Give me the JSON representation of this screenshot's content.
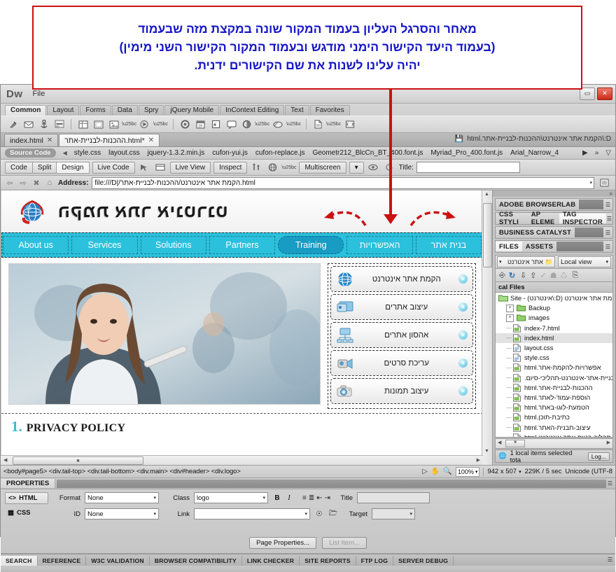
{
  "callout": {
    "line1": "מאחר והסרגל העליון בעמוד המקור שונה במקצת מזה שבעמוד",
    "line2": "(בעמוד היעד הקישור הימני מודגש ובעמוד המקור הקישור השני מימין)",
    "line3": "יהיה עלינו לשנות את שם הקישורים ידנית."
  },
  "window": {
    "app_logo": "Dw",
    "menu_file": "File",
    "minimize": "▭",
    "close": "✕"
  },
  "insert_panel": {
    "categories": [
      "Common",
      "Layout",
      "Forms",
      "Data",
      "Spry",
      "jQuery Mobile",
      "InContext Editing",
      "Text",
      "Favorites"
    ],
    "active_category": "Common"
  },
  "doc_tabs": [
    {
      "label": "index.html",
      "close": "✕",
      "active": false
    },
    {
      "label": "ההכנות-לבניית-אתר.html*",
      "close": "✕",
      "active": true
    }
  ],
  "doc_path": "D:\\הקמת אתר אינטרנט\\ההכנות-לבניית-אתר.html",
  "related_files": {
    "source_code": "Source Code",
    "files": [
      "style.css",
      "layout.css",
      "jquery-1.3.2.min.js",
      "cufon-yui.js",
      "cufon-replace.js",
      "Geometr212_BlcCn_BT_400.font.js",
      "Myriad_Pro_400.font.js",
      "Arial_Narrow_4"
    ],
    "more": "»",
    "filter": "filter-icon"
  },
  "view_toolbar": {
    "code": "Code",
    "split": "Split",
    "design": "Design",
    "active_view": "Design",
    "live_code": "Live Code",
    "live_view": "Live View",
    "inspect": "Inspect",
    "multiscreen": "Multiscreen",
    "title_label": "Title:",
    "title_value": ""
  },
  "address_bar": {
    "label": "Address:",
    "value": "file:///D|/הקמת אתר אינטרנט/ההכנות-לבניית-אתר.html"
  },
  "site": {
    "logo_text": "הקמת אתר אינטרנט",
    "nav": [
      {
        "label": "בנית אתר",
        "rtl": true,
        "selected": false
      },
      {
        "label": "האפשרויות",
        "rtl": true,
        "selected": false
      },
      {
        "label": "Training",
        "rtl": false,
        "selected": true
      },
      {
        "label": "Partners",
        "rtl": false,
        "selected": false
      },
      {
        "label": "Solutions",
        "rtl": false,
        "selected": false
      },
      {
        "label": "Services",
        "rtl": false,
        "selected": false
      },
      {
        "label": "About us",
        "rtl": false,
        "selected": false
      }
    ],
    "services": [
      {
        "label": "הקמת אתר אינטרנט",
        "icon": "globe-icon"
      },
      {
        "label": "עיצוב אתרים",
        "icon": "monitor-icon"
      },
      {
        "label": "אהסון אתרים",
        "icon": "network-icon"
      },
      {
        "label": "עריכת סרטים",
        "icon": "camcorder-icon"
      },
      {
        "label": "עיצוב תמונות",
        "icon": "camera-icon"
      }
    ],
    "privacy_number": "1.",
    "privacy_title": "PRIVACY POLICY"
  },
  "right_panel": {
    "groups": [
      {
        "tabs": [
          {
            "label": "ADOBE BROWSERLAB",
            "selected": false
          }
        ]
      },
      {
        "tabs": [
          {
            "label": "CSS STYLI",
            "selected": false
          },
          {
            "label": "AP ELEME",
            "selected": false
          },
          {
            "label": "TAG INSPECTOR",
            "selected": true
          }
        ]
      },
      {
        "tabs": [
          {
            "label": "BUSINESS CATALYST",
            "selected": false
          }
        ]
      },
      {
        "tabs": [
          {
            "label": "FILES",
            "selected": true
          },
          {
            "label": "ASSETS",
            "selected": false
          }
        ]
      }
    ],
    "site_select": "אתר אינטרנט",
    "view_select": "Local view",
    "local_files_header": "cal Files",
    "files": [
      {
        "name": "הקמת אתר אינטרנט (D:\\אינטרנט) - Site",
        "type": "site",
        "indent": 0,
        "expandable": false,
        "selected": false,
        "rtl": true
      },
      {
        "name": "Backup",
        "type": "folder",
        "indent": 1,
        "expandable": true,
        "selected": false,
        "rtl": false
      },
      {
        "name": "images",
        "type": "folder",
        "indent": 1,
        "expandable": true,
        "selected": false,
        "rtl": false
      },
      {
        "name": "index-7.html",
        "type": "html",
        "indent": 1,
        "expandable": false,
        "selected": false,
        "rtl": false
      },
      {
        "name": "index.html",
        "type": "html",
        "indent": 1,
        "expandable": false,
        "selected": true,
        "rtl": false
      },
      {
        "name": "layout.css",
        "type": "css",
        "indent": 1,
        "expandable": false,
        "selected": false,
        "rtl": false
      },
      {
        "name": "style.css",
        "type": "css",
        "indent": 1,
        "expandable": false,
        "selected": false,
        "rtl": false
      },
      {
        "name": "אפשרויות-להקמת-אתר.html",
        "type": "html",
        "indent": 1,
        "expandable": false,
        "selected": false,
        "rtl": true
      },
      {
        "name": "בניית-אתר-אינטרנט-תהליכי-סיום.",
        "type": "html",
        "indent": 1,
        "expandable": false,
        "selected": false,
        "rtl": true
      },
      {
        "name": "ההכנות-לבניית-אתר.html",
        "type": "html",
        "indent": 1,
        "expandable": false,
        "selected": false,
        "rtl": true
      },
      {
        "name": "הוספת-עמוד-לאתר.html",
        "type": "html",
        "indent": 1,
        "expandable": false,
        "selected": false,
        "rtl": true
      },
      {
        "name": "הטמעת-לוגו-באתר.html",
        "type": "html",
        "indent": 1,
        "expandable": false,
        "selected": false,
        "rtl": true
      },
      {
        "name": "כתיבת-תוכן.html",
        "type": "html",
        "indent": 1,
        "expandable": false,
        "selected": false,
        "rtl": true
      },
      {
        "name": "עיצוב-תבנית-האתר.html",
        "type": "html",
        "indent": 1,
        "expandable": false,
        "selected": false,
        "rtl": true
      },
      {
        "name": "תהליך-בניית-אתר-אינטרנט.html",
        "type": "html",
        "indent": 1,
        "expandable": false,
        "selected": false,
        "rtl": true
      }
    ],
    "status_text": "1 local items selected tota",
    "log_button": "Log..."
  },
  "status_bar": {
    "tag_path": "<body#page5> <div.tail-top> <div.tail-bottom> <div.main> <div#header> <div.logo>",
    "zoom": "100%",
    "dimensions": "942 x 507",
    "size_time": "229K / 5 sec",
    "encoding": "Unicode (UTF-8"
  },
  "properties": {
    "panel_title": "PROPERTIES",
    "html_mode": "HTML",
    "css_mode": "CSS",
    "format_label": "Format",
    "format_value": "None",
    "id_label": "ID",
    "id_value": "None",
    "class_label": "Class",
    "class_value": "logo",
    "link_label": "Link",
    "link_value": "",
    "bold": "B",
    "italic": "I",
    "title_label": "Title",
    "title_value": "",
    "target_label": "Target",
    "target_value": "",
    "page_properties_button": "Page Properties...",
    "list_item_button": "List Item..."
  },
  "results_tabs": [
    "SEARCH",
    "REFERENCE",
    "W3C VALIDATION",
    "BROWSER COMPATIBILITY",
    "LINK CHECKER",
    "SITE REPORTS",
    "FTP LOG",
    "SERVER DEBUG"
  ],
  "results_active": "SEARCH",
  "colors": {
    "callout_border": "#cc1111",
    "callout_text": "#1616c8",
    "nav_teal": "#2bc0dc",
    "nav_selected": "#189cc4",
    "privacy_accent": "#49b6d4"
  }
}
